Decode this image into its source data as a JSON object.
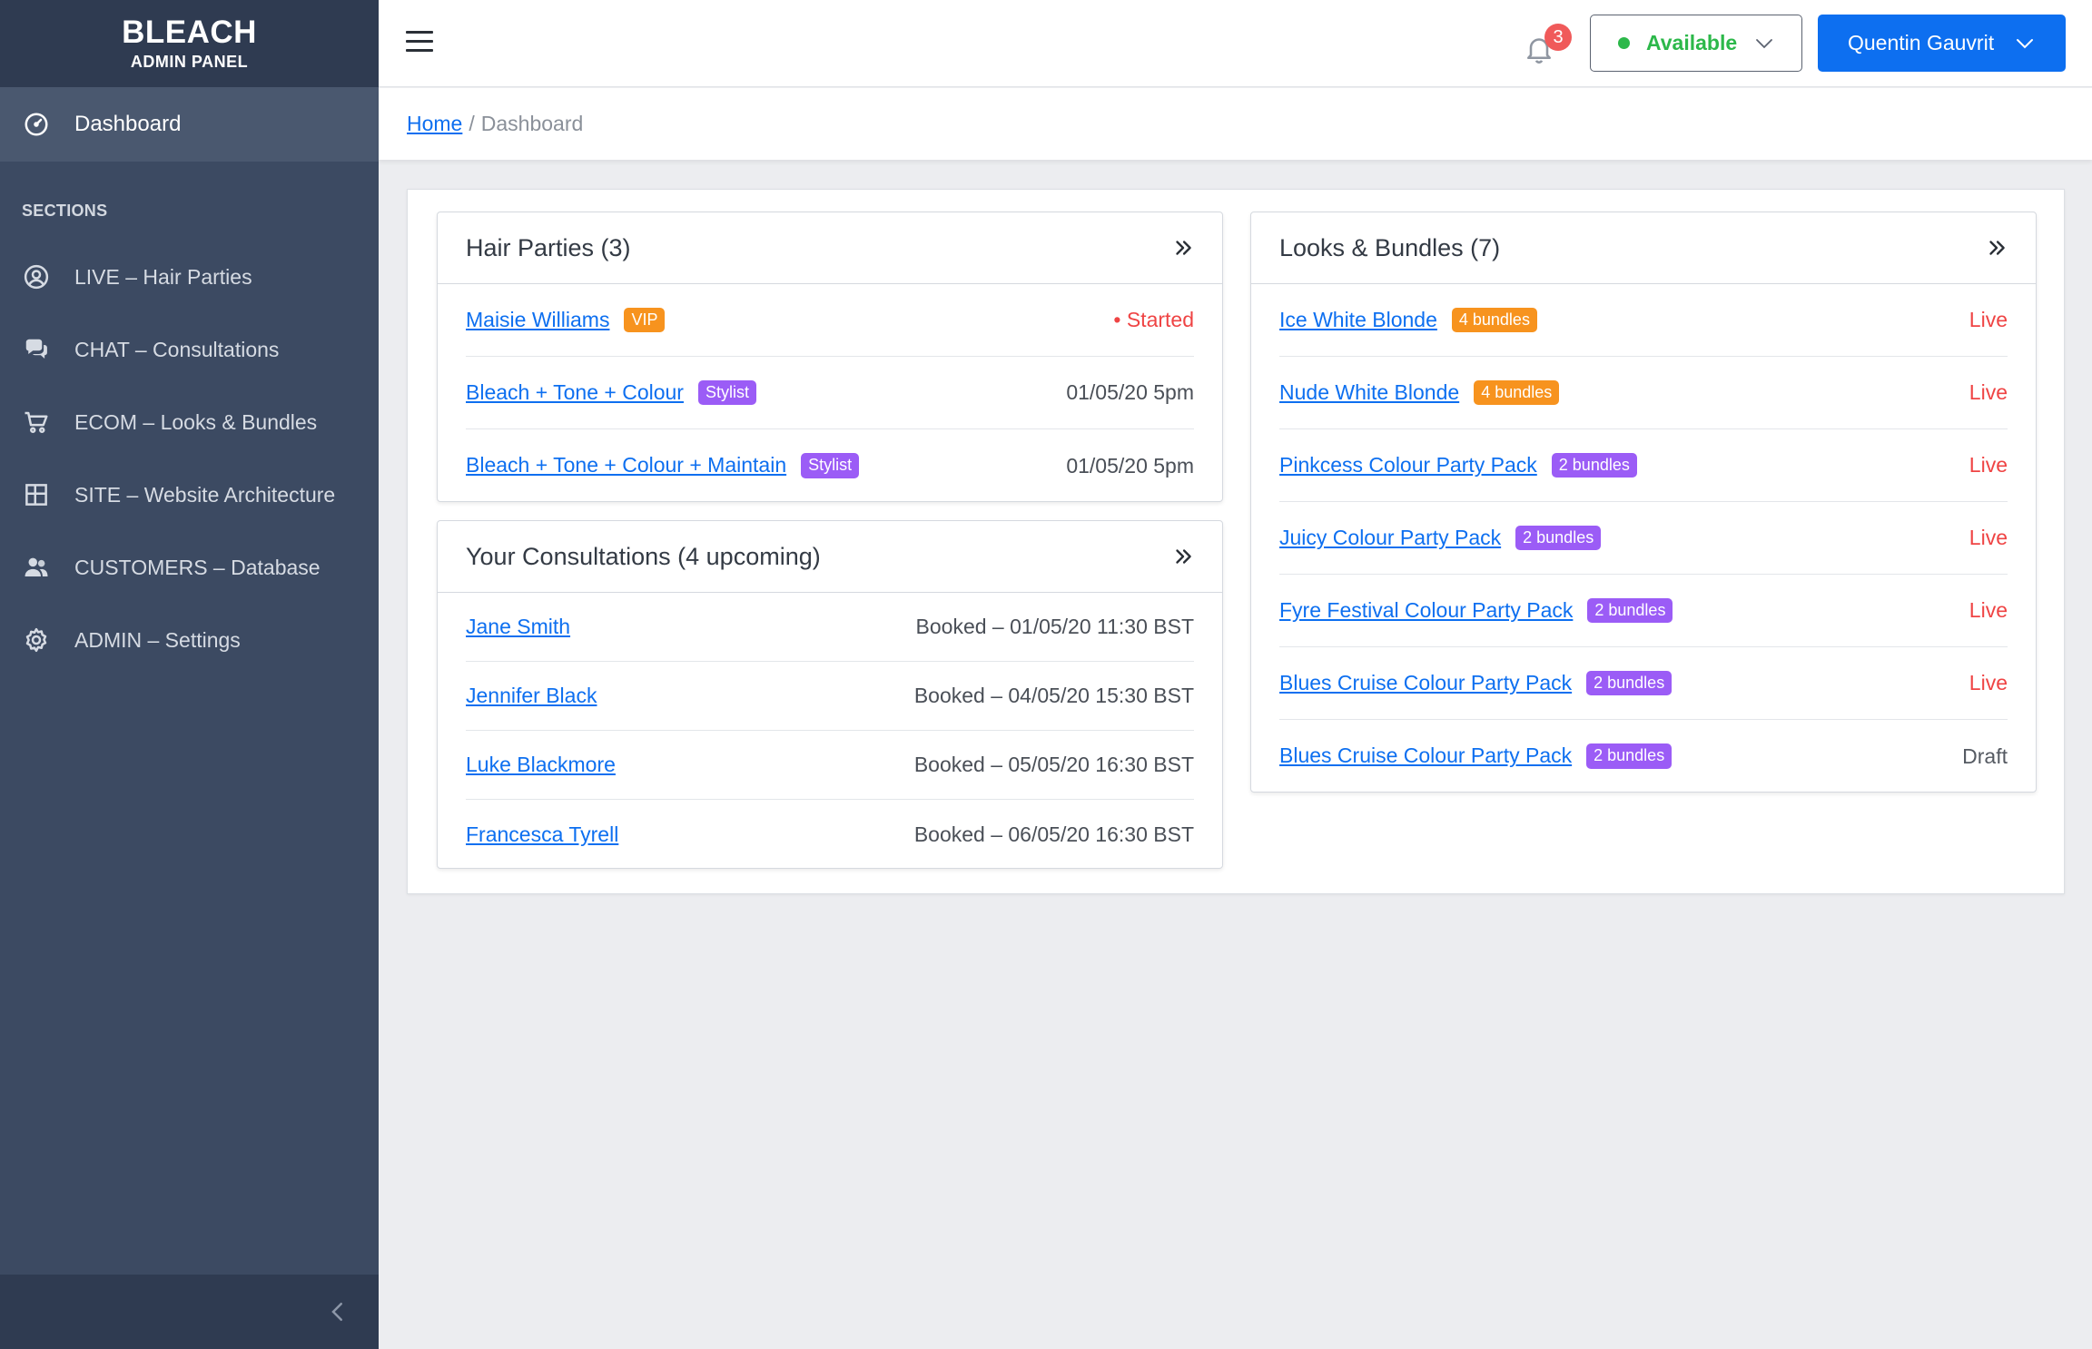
{
  "brand": {
    "title": "BLEACH",
    "subtitle": "ADMIN PANEL"
  },
  "sidebar": {
    "active": {
      "label": "Dashboard",
      "icon": "dashboard-icon"
    },
    "section_title": "SECTIONS",
    "items": [
      {
        "label": "LIVE – Hair Parties",
        "icon": "user-circle-icon"
      },
      {
        "label": "CHAT – Consultations",
        "icon": "chat-icon"
      },
      {
        "label": "ECOM – Looks & Bundles",
        "icon": "cart-icon"
      },
      {
        "label": "SITE – Website Architecture",
        "icon": "layout-icon"
      },
      {
        "label": "CUSTOMERS – Database",
        "icon": "users-icon"
      },
      {
        "label": "ADMIN – Settings",
        "icon": "gear-icon"
      }
    ]
  },
  "topbar": {
    "notifications_count": "3",
    "status_label": "Available",
    "user_name": "Quentin Gauvrit"
  },
  "breadcrumb": {
    "home": "Home",
    "separator": "/",
    "current": "Dashboard"
  },
  "hair_parties": {
    "title": "Hair Parties (3)",
    "rows": [
      {
        "name": "Maisie Williams",
        "badge": "VIP",
        "right": "• Started"
      },
      {
        "name": "Bleach + Tone + Colour",
        "badge": "Stylist",
        "right": "01/05/20 5pm"
      },
      {
        "name": "Bleach + Tone + Colour + Maintain",
        "badge": "Stylist",
        "right": "01/05/20 5pm"
      }
    ]
  },
  "consultations": {
    "title": "Your Consultations (4 upcoming)",
    "rows": [
      {
        "name": "Jane Smith",
        "right": "Booked – 01/05/20 11:30 BST"
      },
      {
        "name": "Jennifer Black",
        "right": "Booked – 04/05/20 15:30 BST"
      },
      {
        "name": "Luke Blackmore",
        "right": "Booked – 05/05/20 16:30 BST"
      },
      {
        "name": "Francesca Tyrell",
        "right": "Booked – 06/05/20 16:30 BST"
      }
    ]
  },
  "looks": {
    "title": "Looks & Bundles (7)",
    "rows": [
      {
        "name": "Ice White Blonde",
        "badge": "4 bundles",
        "right": "Live"
      },
      {
        "name": "Nude White Blonde",
        "badge": "4 bundles",
        "right": "Live"
      },
      {
        "name": "Pinkcess Colour Party Pack",
        "badge": "2 bundles",
        "right": "Live"
      },
      {
        "name": "Juicy Colour Party Pack",
        "badge": "2 bundles",
        "right": "Live"
      },
      {
        "name": "Fyre Festival Colour Party Pack",
        "badge": "2 bundles",
        "right": "Live"
      },
      {
        "name": "Blues Cruise Colour Party Pack",
        "badge": "2 bundles",
        "right": "Live"
      },
      {
        "name": "Blues Cruise Colour Party Pack",
        "badge": "2 bundles",
        "right": "Draft"
      }
    ]
  },
  "colors": {
    "sidebar": "#3c4a62",
    "accent_blue": "#0d6ff0",
    "status_green": "#2cb84a",
    "live_red": "#ef4444",
    "badge_orange": "#f7931e",
    "badge_purple": "#9b5cf6"
  }
}
